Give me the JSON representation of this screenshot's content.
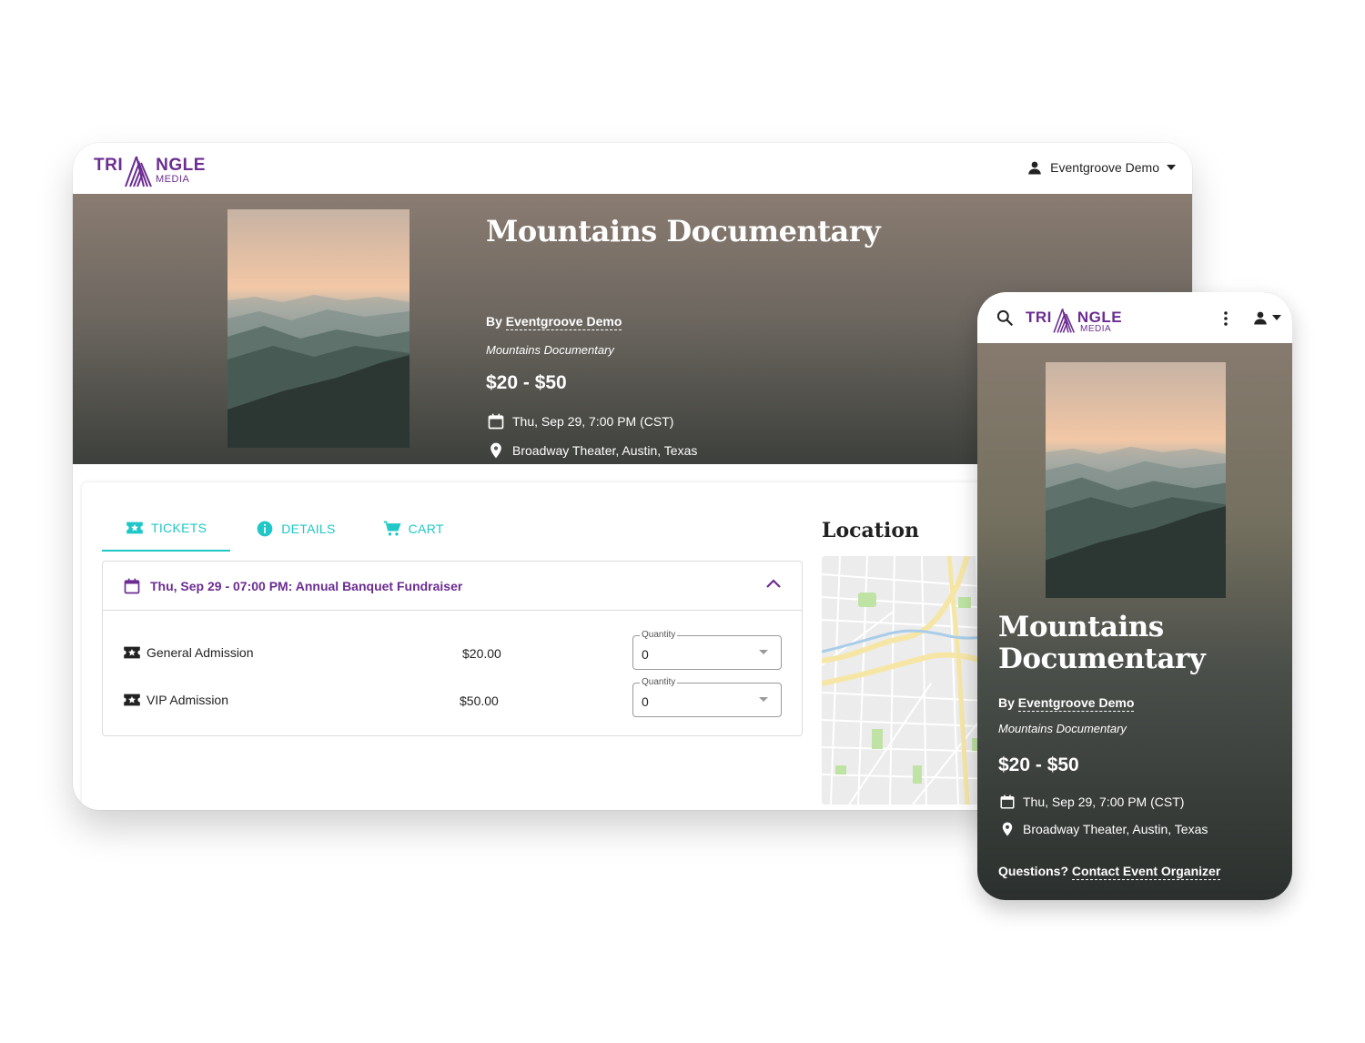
{
  "brand": {
    "logo_left": "TRI",
    "logo_right": "NGLE",
    "logo_sub": "MEDIA",
    "color": "#6b2d91"
  },
  "user": {
    "name": "Eventgroove Demo"
  },
  "event": {
    "title": "Mountains Documentary",
    "by_prefix": "By",
    "organizer": "Eventgroove Demo",
    "subtitle": "Mountains Documentary",
    "price_range": "$20 - $50",
    "date": "Thu, Sep 29, 7:00 PM (CST)",
    "location": "Broadway Theater, Austin, Texas"
  },
  "tabs": [
    {
      "label": "TICKETS",
      "icon": "ticket-star-icon",
      "active": true
    },
    {
      "label": "DETAILS",
      "icon": "info-icon",
      "active": false
    },
    {
      "label": "CART",
      "icon": "cart-icon",
      "active": false
    }
  ],
  "accordion": {
    "title": "Thu, Sep 29 - 07:00 PM: Annual Banquet Fundraiser",
    "tickets": [
      {
        "name": "General Admission",
        "price": "$20.00",
        "quantity_label": "Quantity",
        "quantity": "0"
      },
      {
        "name": "VIP Admission",
        "price": "$50.00",
        "quantity_label": "Quantity",
        "quantity": "0"
      }
    ]
  },
  "location_heading": "Location",
  "mobile": {
    "questions_prefix": "Questions?",
    "contact_link": "Contact Event Organizer"
  },
  "colors": {
    "accent": "#1fc7c7",
    "brand": "#6b2d91"
  }
}
